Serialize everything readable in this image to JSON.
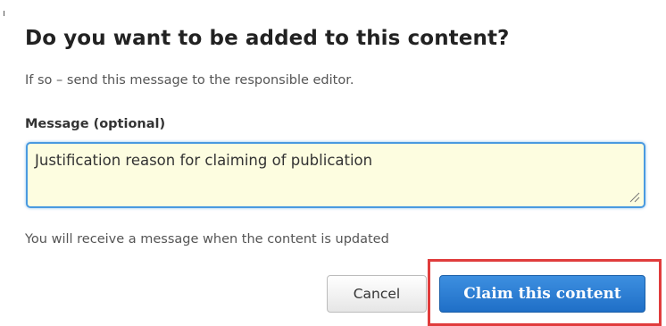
{
  "dialog": {
    "title": "Do you want to be added to this content?",
    "subtitle": "If so – send this message to the responsible editor.",
    "message_label": "Message (optional)",
    "message_value": "Justification reason for claiming of publication",
    "info_text": "You will receive a message when the content is updated",
    "cancel_label": "Cancel",
    "claim_label": "Claim this content"
  },
  "icons": {
    "resize": "resize-handle-icon"
  },
  "colors": {
    "primary_button": "#2a7fd4",
    "input_background": "#fdfde0",
    "input_focus_border": "#4a9ae0",
    "highlight_border": "#e03c3c"
  }
}
